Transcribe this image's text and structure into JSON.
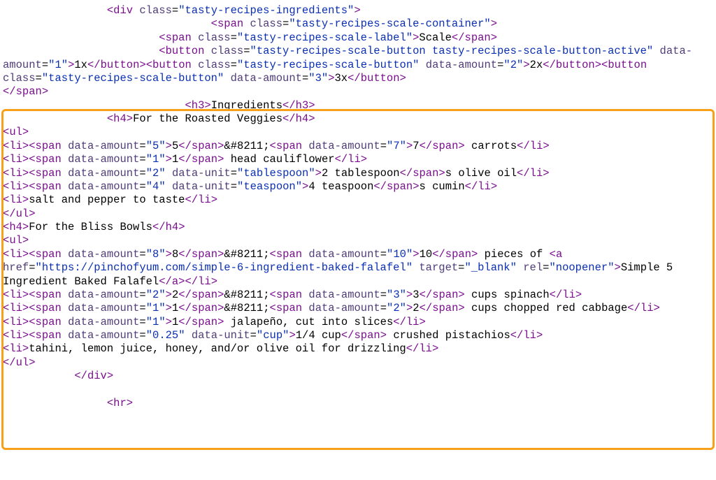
{
  "indent": {
    "i1": "        ",
    "i2": "                ",
    "i3": "                        ",
    "i4": "                                "
  },
  "tags": {
    "div": "div",
    "span": "span",
    "button": "button",
    "h3": "h3",
    "h4": "h4",
    "ul": "ul",
    "li": "li",
    "a": "a",
    "hr": "hr"
  },
  "attrs": {
    "class": "class",
    "data_amount": "data-amount",
    "data_unit": "data-unit",
    "href": "href",
    "target": "target",
    "rel": "rel"
  },
  "classes": {
    "ingredients": "tasty-recipes-ingredients",
    "scale_container": "tasty-recipes-scale-container",
    "scale_label": "tasty-recipes-scale-label",
    "scale_button": "tasty-recipes-scale-button",
    "scale_button_active": "tasty-recipes-scale-button tasty-recipes-scale-button-active"
  },
  "values": {
    "amount_1": "1",
    "amount_2": "2",
    "amount_3": "3",
    "amount_4": "4",
    "amount_5": "5",
    "amount_7": "7",
    "amount_8": "8",
    "amount_10": "10",
    "amount_025": "0.25",
    "unit_tbsp": "tablespoon",
    "unit_tsp": "teaspoon",
    "unit_cup": "cup",
    "href_falafel": "https://pinchofyum.com/simple-6-ingredient-baked-falafel",
    "target_blank": "_blank",
    "rel_noopener": "noopener"
  },
  "text": {
    "scale": "Scale",
    "x1": "1x",
    "x2": "2x",
    "x3": "3x",
    "ingredients_h3": "Ingredients",
    "roasted_veggies_h4": "For the Roasted Veggies",
    "bliss_bowls_h4": "For the Bliss Bowls",
    "dash_entity": "&#8211;",
    "n5": "5",
    "n7": "7",
    "n1": "1",
    "n2": "2",
    "n3": "3",
    "n4": "4",
    "n8": "8",
    "n10": "10",
    "two_tbsp": "2 tablespoon",
    "four_tsp": "4 teaspoon",
    "quarter_cup": "1/4 cup",
    "carrots": " carrots",
    "head_cauli": " head cauliflower",
    "s_olive_oil": "s olive oil",
    "s_cumin": "s cumin",
    "salt_pepper": "salt and pepper to taste",
    "pieces_of": " pieces of ",
    "falafel_link": "Simple 5 Ingredient Baked Falafel",
    "cups_spinach": " cups spinach",
    "cups_cabbage": " cups chopped red cabbage",
    "jalapeno": " jalapeño, cut into slices",
    "pistachios": " crushed pistachios",
    "drizzling": "tahini, lemon juice, honey, and/or olive oil for drizzling"
  }
}
